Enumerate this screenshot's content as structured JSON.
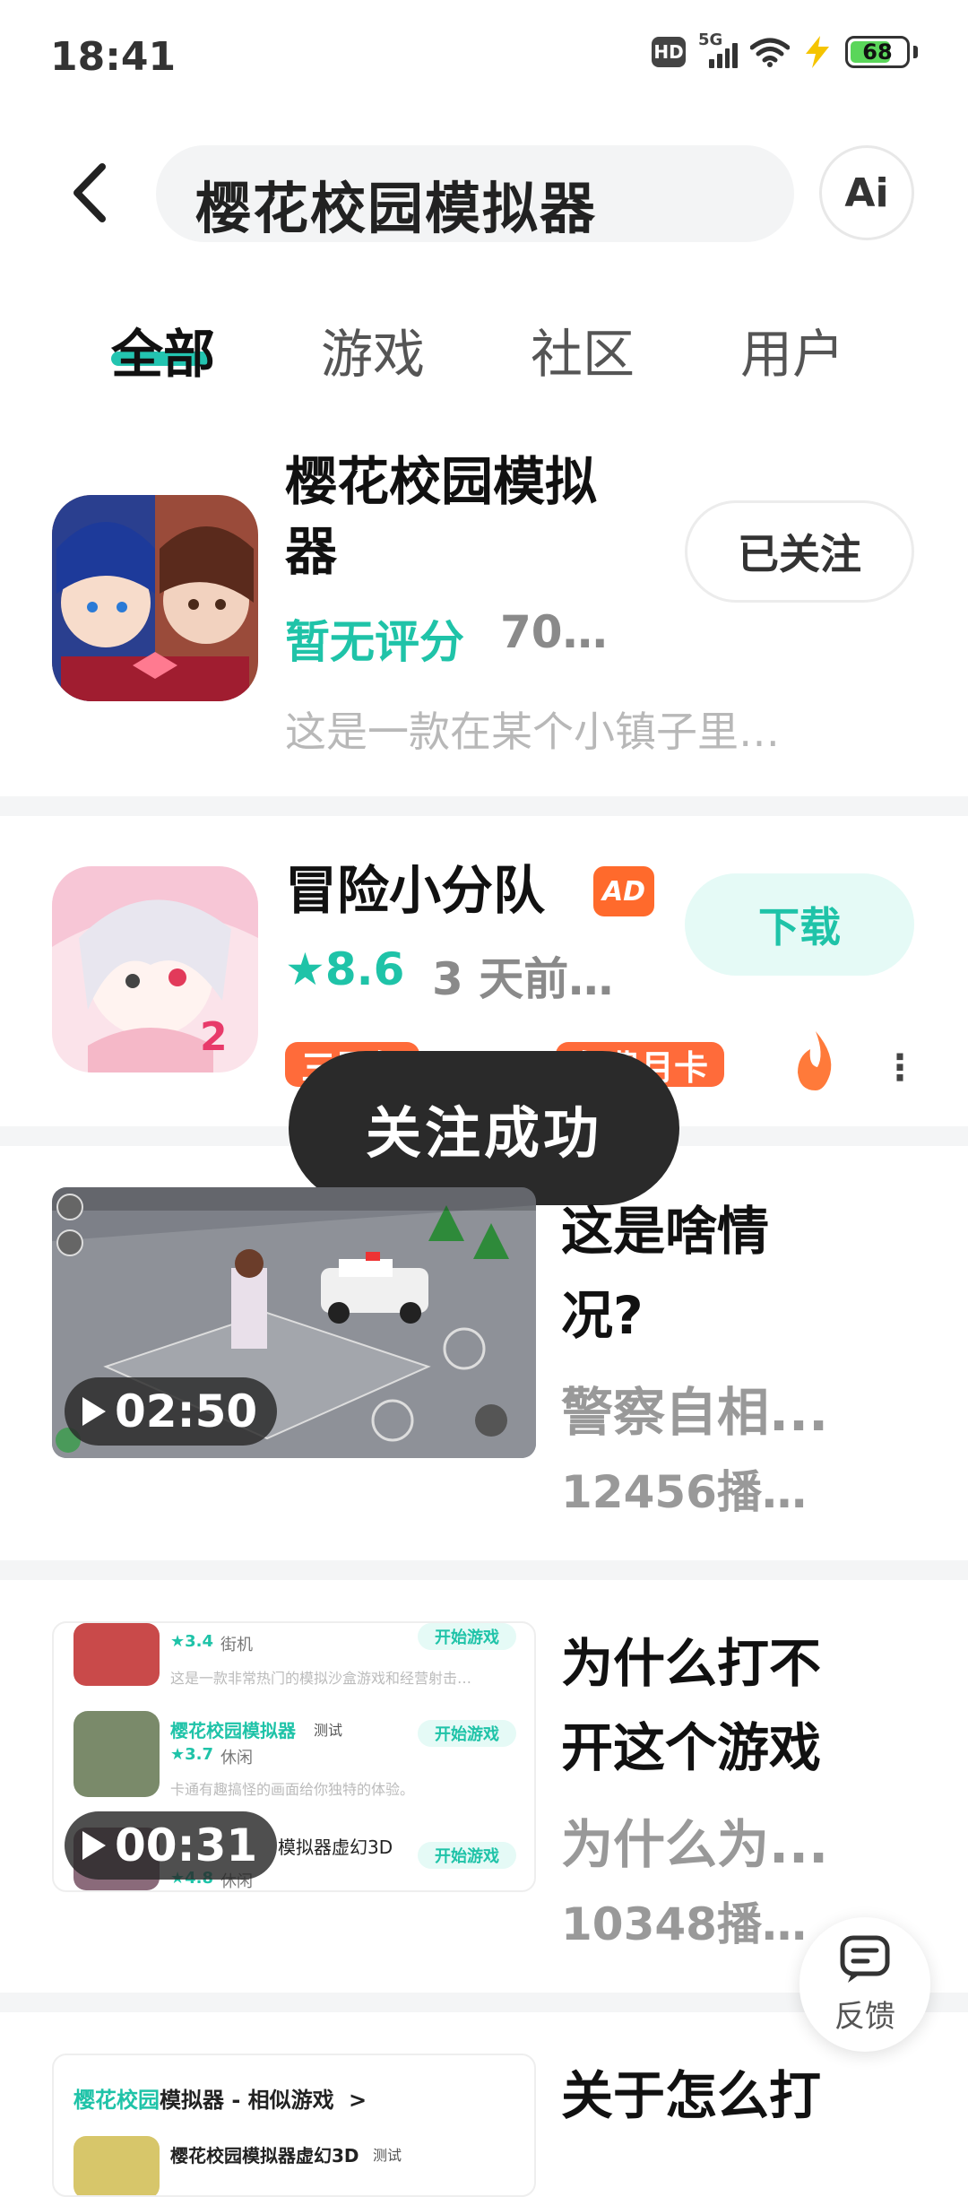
{
  "status_bar": {
    "time": "18:41",
    "hd": "HD",
    "network": "5G",
    "battery": "68"
  },
  "header": {
    "search_query": "樱花校园模拟器",
    "ai_label": "Ai"
  },
  "tabs": [
    {
      "label": "全部",
      "active": true
    },
    {
      "label": "游戏",
      "active": false
    },
    {
      "label": "社区",
      "active": false
    },
    {
      "label": "用户",
      "active": false
    }
  ],
  "results": {
    "game1": {
      "title_line1": "樱花校园模拟",
      "title_line2": "器",
      "rating": "暂无评分",
      "meta": "70…",
      "description": "这是一款在某个小镇子里…",
      "follow_label": "已关注"
    },
    "game2": {
      "title": "冒险小分队",
      "ad_label": "AD",
      "rating": "★8.6",
      "meta": "3 天前…",
      "download_label": "下载",
      "promo1": "三周年",
      "promo2": "免费月卡",
      "more": "⋮"
    },
    "video1": {
      "duration": "02:50",
      "title_line1": "这是啥情",
      "title_line2": "况?",
      "subtitle": "警察自相...",
      "plays": "12456播…"
    },
    "video2": {
      "duration": "00:31",
      "title_line1": "为什么打不",
      "title_line2": "开这个游戏",
      "subtitle": "为什么为...",
      "plays": "10348播…",
      "thumb_rows": [
        {
          "rating": "★3.4",
          "tag": "街机",
          "desc": "这是一款非常热门的模拟沙盒游戏和经营射击…",
          "button": "开始游戏"
        },
        {
          "name": "樱花校园模拟器",
          "badge": "测试",
          "rating": "★3.7",
          "tag": "休闲",
          "desc": "卡通有趣搞怪的画面给你独特的体验。",
          "button": "开始游戏"
        },
        {
          "name_suffix": "模拟器虚幻3D",
          "rating": "★4.8",
          "tag": "休闲",
          "button": "开始游戏"
        }
      ]
    },
    "video3": {
      "title_line1": "关于怎么打",
      "thumb_header_green": "樱花校园",
      "thumb_header_rest": "模拟器 - 相似游戏",
      "thumb_header_arrow": ">",
      "thumb_row_name": "樱花校园模拟器虚幻3D",
      "thumb_row_badge": "测试"
    }
  },
  "toast": "关注成功",
  "feedback_label": "反馈",
  "colors": {
    "accent": "#1fc3a8",
    "ad_orange": "#ff6a2c",
    "toast_bg": "#2a2a2a"
  }
}
